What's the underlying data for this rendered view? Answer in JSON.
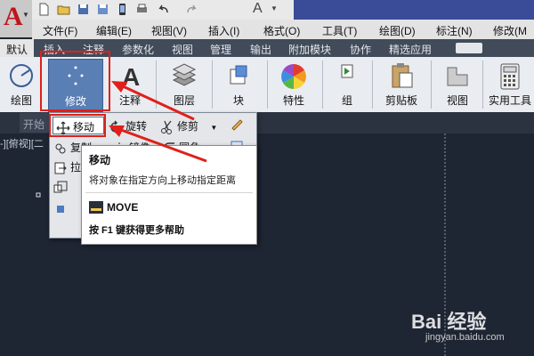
{
  "quick_access": {
    "workspace_arrow": "▼",
    "text_style": "A"
  },
  "menu": [
    "文件(F)",
    "编辑(E)",
    "视图(V)",
    "插入(I)",
    "格式(O)",
    "工具(T)",
    "绘图(D)",
    "标注(N)",
    "修改(M"
  ],
  "ribbon_tabs": [
    "默认",
    "插入",
    "注释",
    "参数化",
    "视图",
    "管理",
    "输出",
    "附加模块",
    "协作",
    "精选应用"
  ],
  "ribbon_buttons": {
    "draw": "绘图",
    "modify": "修改",
    "annotate": "注释",
    "layers": "图层",
    "block": "块",
    "properties": "特性",
    "group": "组",
    "clipboard": "剪贴板",
    "view": "视图",
    "utilities": "实用工具"
  },
  "doc_tab": "开始",
  "modify_panel": {
    "move": "移动",
    "rotate": "旋转",
    "trim": "修剪",
    "copy": "复制",
    "mirror": "镜像",
    "fillet": "圆角",
    "stretch": "拉"
  },
  "tooltip": {
    "title": "移动",
    "description": "将对象在指定方向上移动指定距离",
    "command": "MOVE",
    "help": "按 F1 键获得更多帮助"
  },
  "viewport_label": "-][俯视][二",
  "watermark": {
    "brand": "Bai 经验",
    "url": "jingyan.baidu.com"
  },
  "colors": {
    "accent": "#5a7fb5",
    "highlight": "#e0201b",
    "canvas": "#1e2533"
  }
}
